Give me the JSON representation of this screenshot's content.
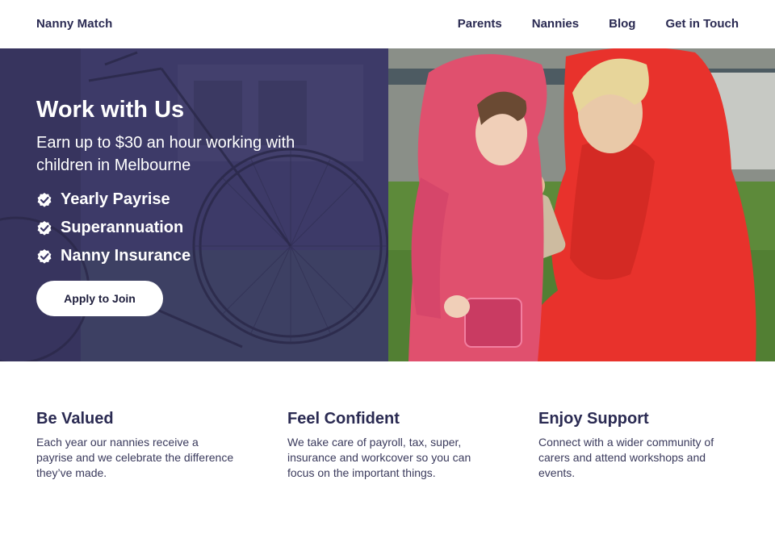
{
  "brand": {
    "name": "Nanny Match"
  },
  "nav": {
    "items": [
      {
        "label": "Parents"
      },
      {
        "label": "Nannies"
      },
      {
        "label": "Blog"
      },
      {
        "label": "Get in Touch"
      }
    ]
  },
  "hero": {
    "title": "Work with Us",
    "subtitle": "Earn up to $30 an hour working with children in Melbourne",
    "benefits": [
      {
        "label": "Yearly Payrise",
        "icon": "check-badge-icon"
      },
      {
        "label": "Superannuation",
        "icon": "check-badge-icon"
      },
      {
        "label": "Nanny Insurance",
        "icon": "check-badge-icon"
      }
    ],
    "cta_label": "Apply to Join",
    "overlay_color": "#3d3a68"
  },
  "features": [
    {
      "title": "Be Valued",
      "text": "Each year our nannies receive a payrise and we celebrate the difference they’ve made."
    },
    {
      "title": "Feel Confident",
      "text": "We take care of payroll, tax, super, insurance and workcover so you can focus on the important things."
    },
    {
      "title": "Enjoy Support",
      "text": "Connect with a wider community of carers and attend workshops and events."
    }
  ],
  "colors": {
    "primary_text": "#2a2a52",
    "raincoat_red": "#e8322c",
    "raincoat_pink": "#e0506e"
  }
}
